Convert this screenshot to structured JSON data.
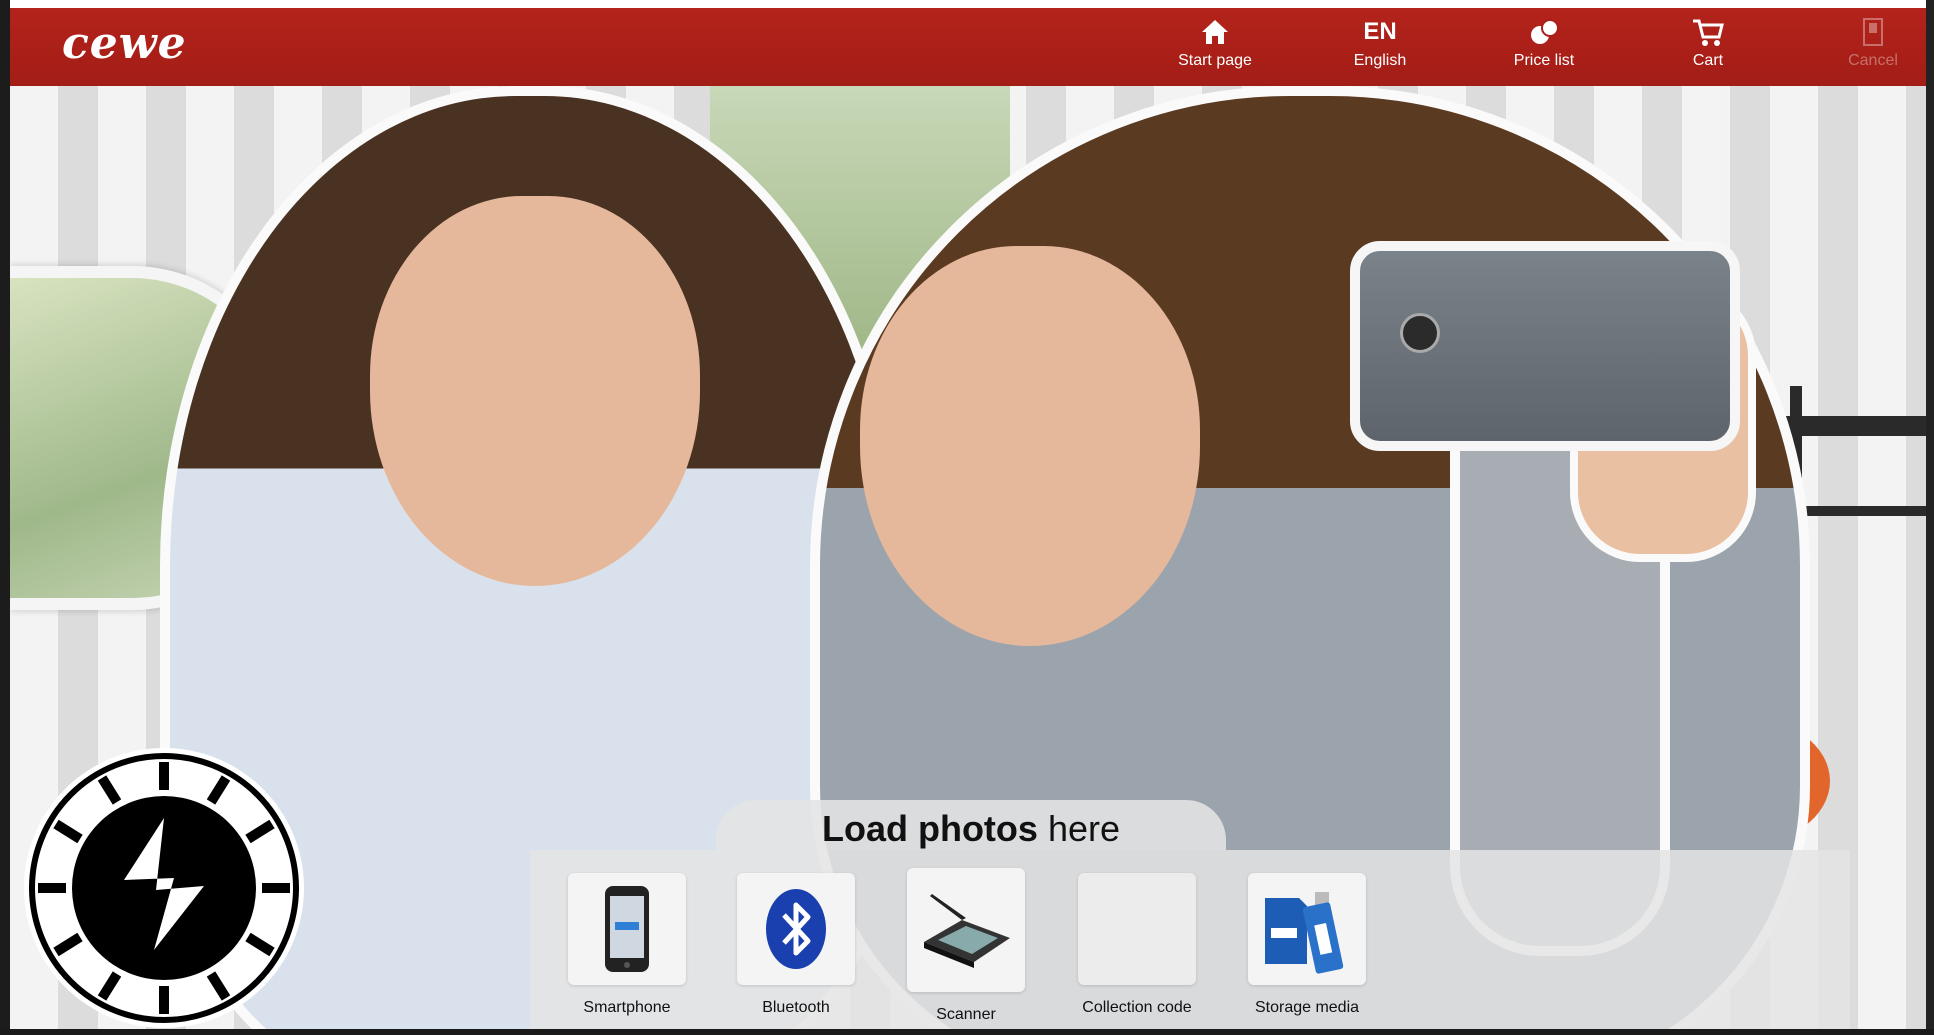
{
  "header": {
    "logo_text": "cewe",
    "nav": [
      {
        "label": "Start page",
        "icon": "home-icon"
      },
      {
        "label": "English",
        "code": "EN",
        "icon": "language-icon"
      },
      {
        "label": "Price list",
        "icon": "price-list-icon"
      },
      {
        "label": "Cart",
        "icon": "cart-icon"
      },
      {
        "label": "Cancel",
        "icon": "cancel-icon",
        "enabled": false
      }
    ]
  },
  "load_panel": {
    "title_bold": "Load photos",
    "title_rest": "here",
    "options": [
      {
        "label": "Smartphone",
        "icon": "smartphone-icon"
      },
      {
        "label": "Bluetooth",
        "icon": "bluetooth-icon"
      },
      {
        "label": "Scanner",
        "icon": "scanner-icon"
      },
      {
        "label": "Collection code",
        "icon": "collection-code-icon"
      },
      {
        "label": "Storage media",
        "icon": "storage-media-icon"
      }
    ]
  },
  "colors": {
    "header_red": "#a91f18",
    "panel_bg": "#e4e4e4"
  }
}
